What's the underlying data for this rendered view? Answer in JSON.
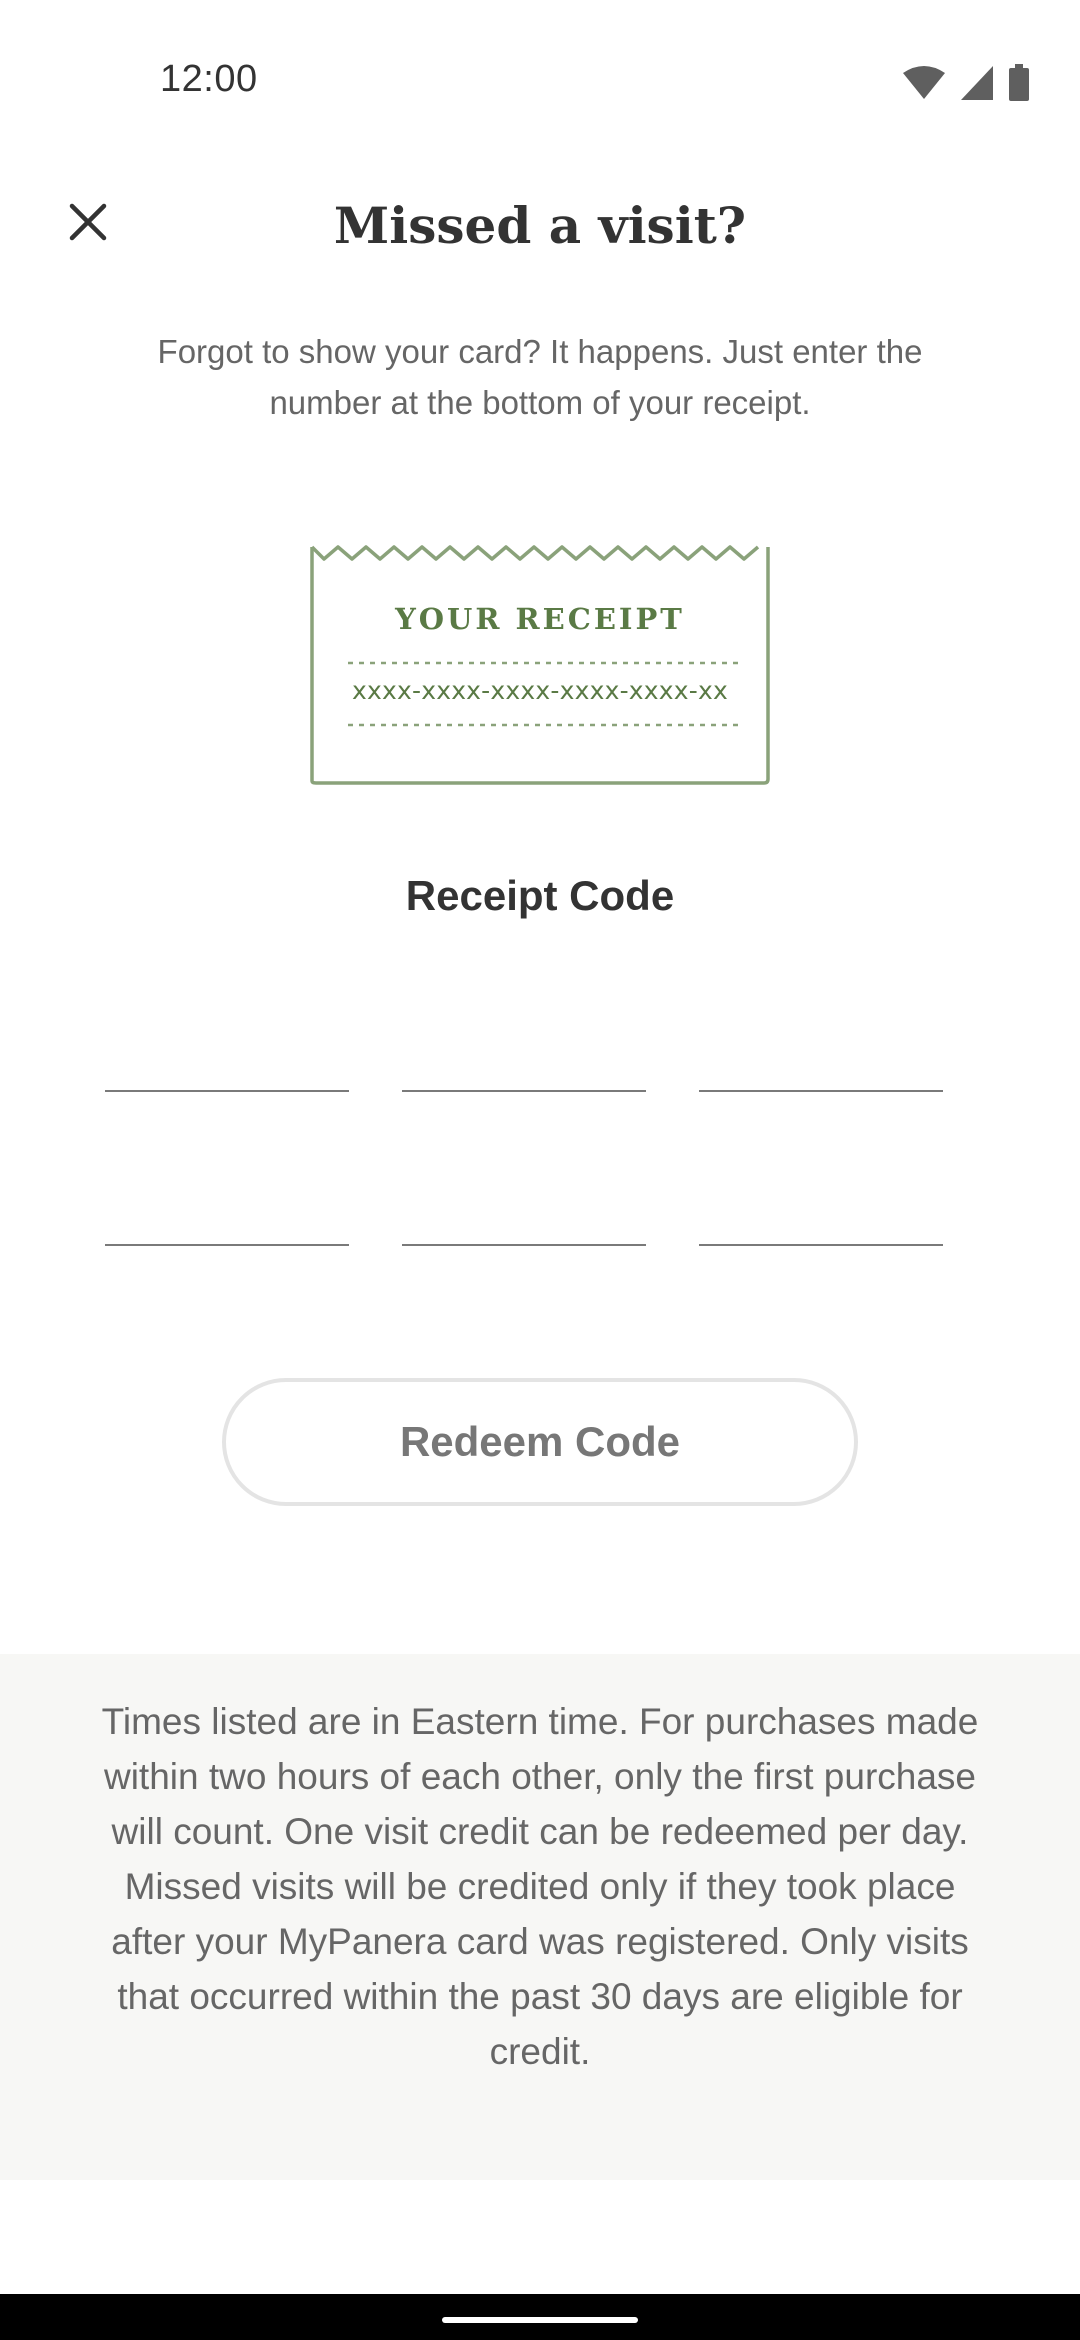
{
  "status_bar": {
    "time": "12:00"
  },
  "header": {
    "title": "Missed a visit?"
  },
  "intro": {
    "text": "Forgot to show your card? It happens. Just enter the number at the bottom of your receipt."
  },
  "receipt_illustration": {
    "title": "YOUR RECEIPT",
    "code_format": "xxxx-xxxx-xxxx-xxxx-xxxx-xx",
    "color": "#5a7a45"
  },
  "receipt_code": {
    "label": "Receipt Code",
    "fields": [
      "",
      "",
      "",
      "",
      "",
      ""
    ]
  },
  "redeem": {
    "label": "Redeem Code"
  },
  "disclaimer": {
    "text": "Times listed are in Eastern time. For purchases made within two hours of each other, only the first purchase will count. One visit credit can be redeemed per day. Missed visits will be credited only if they took place after your MyPanera card was registered. Only visits that occurred within the past 30 days are eligible for credit."
  },
  "icons": {
    "close": "close-icon",
    "wifi": "wifi-icon",
    "signal": "cellular-signal-icon",
    "battery": "battery-icon"
  },
  "colors": {
    "accent_green": "#5a7a45",
    "text_primary": "#333333",
    "text_secondary": "#666666",
    "disclaimer_bg": "#f7f7f5"
  }
}
